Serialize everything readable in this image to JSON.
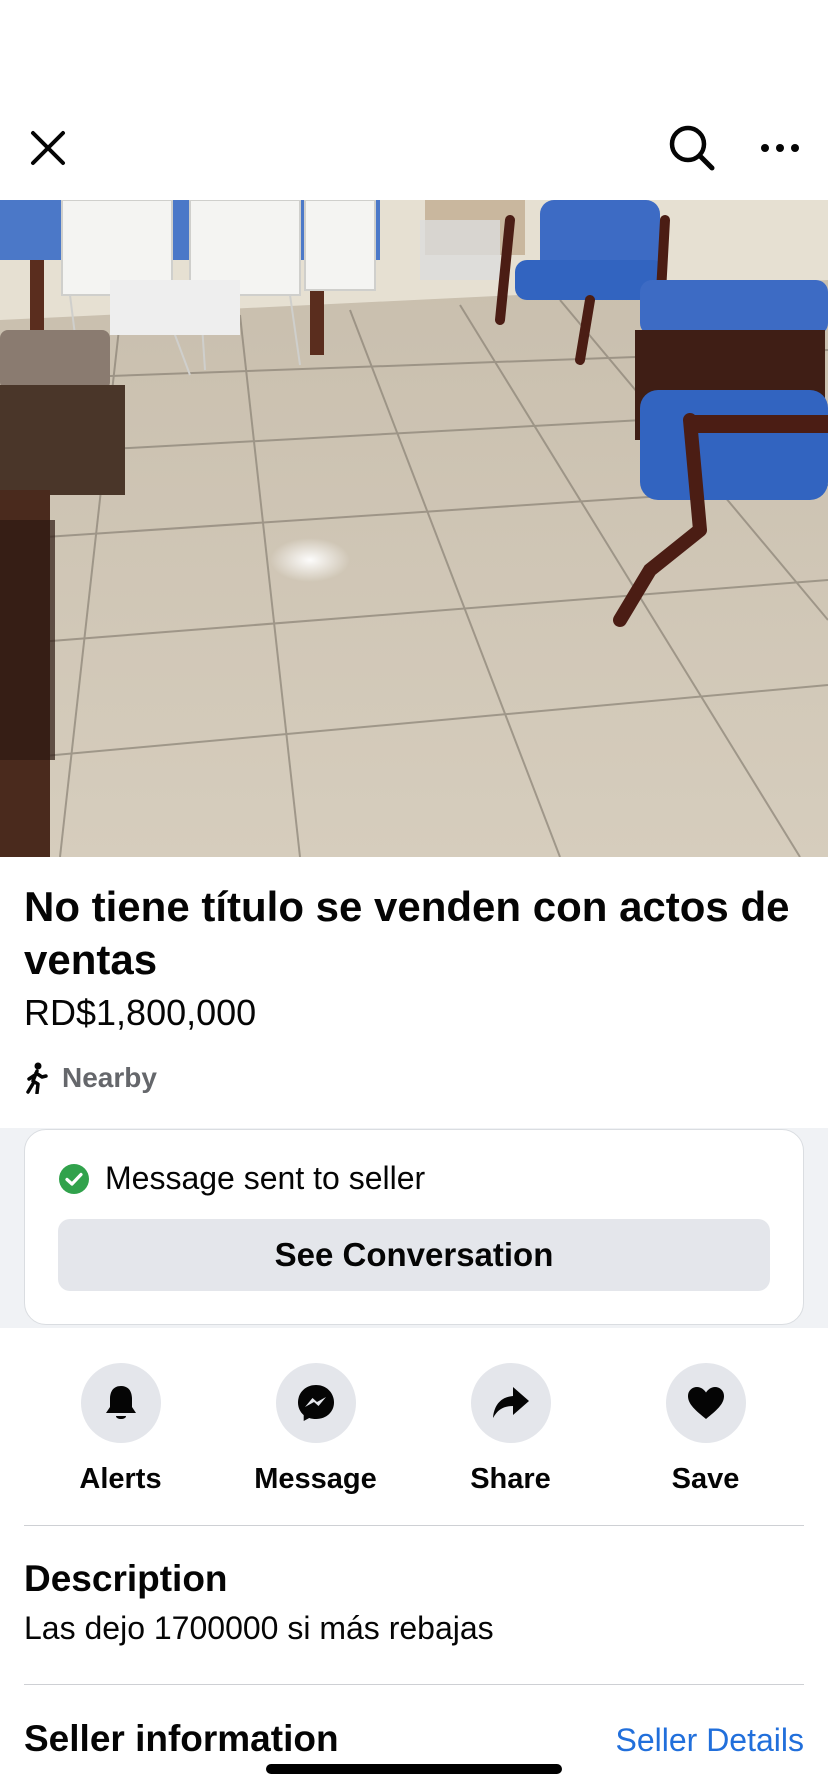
{
  "header": {
    "close_icon": "close-icon",
    "search_icon": "search-icon",
    "more_icon": "more-icon"
  },
  "photo": {
    "description_icon": "listing-photo",
    "page_count": 10,
    "active_index": 0
  },
  "listing": {
    "title": "No tiene título se venden con actos de ventas",
    "price": "RD$1,800,000",
    "location": "Nearby"
  },
  "message_card": {
    "status": "Message sent to seller",
    "button_label": "See Conversation",
    "status_color": "#31a24c"
  },
  "actions": [
    {
      "label": "Alerts",
      "icon": "bell-icon"
    },
    {
      "label": "Message",
      "icon": "messenger-icon"
    },
    {
      "label": "Share",
      "icon": "share-icon"
    },
    {
      "label": "Save",
      "icon": "heart-icon"
    }
  ],
  "description": {
    "heading": "Description",
    "text": "Las dejo 1700000 si más rebajas"
  },
  "seller": {
    "heading": "Seller information",
    "link_label": "Seller Details",
    "link_color": "#216fdb"
  }
}
